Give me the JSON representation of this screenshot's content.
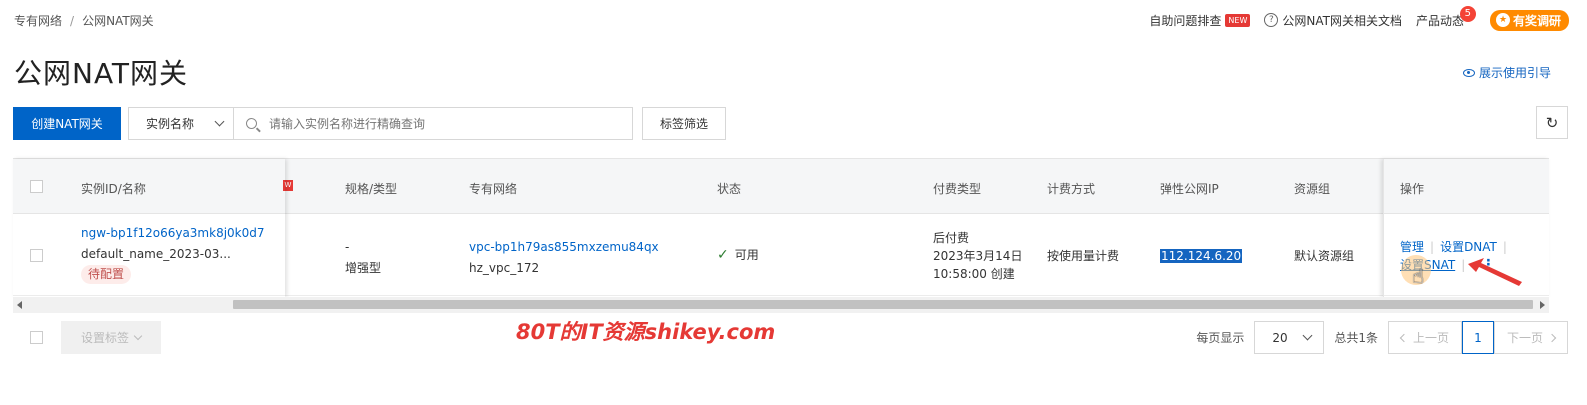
{
  "breadcrumb": [
    "专有网络",
    "/",
    "公网NAT网关"
  ],
  "topbar": {
    "self_help": "自助问题排查",
    "new_badge": "NEW",
    "docs": "公网NAT网关相关文档",
    "product_news": "产品动态",
    "news_count": "5",
    "reward": "有奖调研"
  },
  "page_title": "公网NAT网关",
  "guide_link": "展示使用引导",
  "toolbar": {
    "create_label": "创建NAT网关",
    "filter_select": "实例名称",
    "search_placeholder": "请输入实例名称进行精确查询",
    "tag_filter_label": "标签筛选"
  },
  "table": {
    "headers": [
      "实例ID/名称",
      "规格/类型",
      "专有网络",
      "状态",
      "付费类型",
      "计费方式",
      "弹性公网IP",
      "资源组",
      "操作"
    ],
    "rows": [
      {
        "id": "ngw-bp1f12o66ya3mk8j0k0d7",
        "name": "default_name_2023-03...",
        "tag": "待配置",
        "spec": "-",
        "type": "增强型",
        "vpc_id": "vpc-bp1h79as855mxzemu84qx",
        "vpc_name": "hz_vpc_172",
        "status": "可用",
        "pay_type": "后付费",
        "created_date": "2023年3月14日",
        "created_time": "10:58:00 创建",
        "billing": "按使用量计费",
        "eip": "112.124.6.20",
        "resource_group": "默认资源组",
        "actions": {
          "manage": "管理",
          "dnat": "设置DNAT",
          "snat": "设置SNAT"
        }
      }
    ]
  },
  "footer": {
    "set_tags": "设置标签",
    "watermark": "80T的IT资源shikey.com",
    "per_page_label": "每页显示",
    "per_page_value": "20",
    "total": "总共1条",
    "prev": "上一页",
    "current_page": "1",
    "next": "下一页"
  },
  "colors": {
    "primary": "#0064c8",
    "link": "#0064c8",
    "pending_tag_bg": "#fdecea",
    "status_ok": "#2e7d32",
    "annotation_red": "#e53935"
  }
}
